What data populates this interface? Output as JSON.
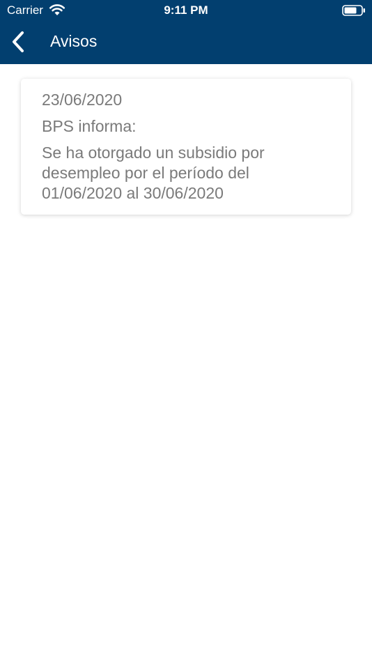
{
  "status_bar": {
    "carrier": "Carrier",
    "time": "9:11 PM",
    "wifi_icon": "wifi-icon",
    "battery_icon": "battery-icon"
  },
  "nav": {
    "back_icon": "chevron-left-icon",
    "title": "Avisos"
  },
  "notices": [
    {
      "date": "23/06/2020",
      "source": "BPS informa:",
      "message": "Se ha otorgado un subsidio por desempleo por el período del 01/06/2020 al 30/06/2020"
    }
  ],
  "colors": {
    "header_background": "#023f6f",
    "header_text": "#ffffff",
    "card_text": "#7a7a7a",
    "page_background": "#ffffff"
  }
}
